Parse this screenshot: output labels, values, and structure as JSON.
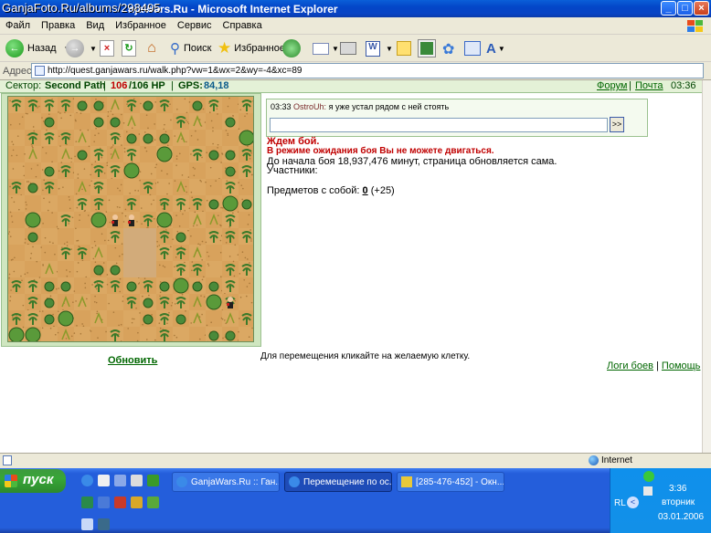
{
  "watermark": "GanjaFoto.Ru/albums/298495",
  "window": {
    "title": "njaWars.Ru - Microsoft Internet Explorer",
    "buttons": [
      "_",
      "□",
      "×"
    ]
  },
  "menu": [
    "Файл",
    "Правка",
    "Вид",
    "Избранное",
    "Сервис",
    "Справка"
  ],
  "toolbar": {
    "back": "Назад",
    "search": "Поиск",
    "favorites": "Избранное"
  },
  "address": {
    "label": "Адрес:",
    "url": "http://quest.ganjawars.ru/walk.php?vw=1&wx=2&wy=-4&xc=89"
  },
  "game": {
    "sector_label": "Сектор:",
    "sector": "Second Path",
    "hp_current": "106",
    "hp_max": "/106 HP",
    "gps_label": "GPS:",
    "gps": "84,18",
    "forum": "Форум",
    "separator": "|",
    "mail": "Почта",
    "time": "03:36",
    "chat_time": "03:33",
    "chat_user": "OstroUh:",
    "chat_text": "я уже устал рядом с ней стоять",
    "send": ">>",
    "wait": "Ждем бой.",
    "no_move": "В режиме ожидания боя Вы не можете двигаться.",
    "countdown": "До начала боя 18,937,476 минут, страница обновляется сама.",
    "participants": "Участники:",
    "items_label": "Предметов с собой:",
    "items_count": "0",
    "items_extra": "(+25)",
    "refresh": "Обновить",
    "hint": "Для перемещения кликайте на желаемую клетку.",
    "battle_logs": "Логи боев",
    "help": "Помощь"
  },
  "status": {
    "zone": "Internet"
  },
  "taskbar": {
    "start": "пуск",
    "tasks": [
      "GanjaWars.Ru :: Ган...",
      "Перемещение по ос...",
      "[285-476-452] - Окн..."
    ],
    "lang": "RL",
    "clock": "3:36",
    "weekday": "вторник",
    "date": "03.01.2006"
  },
  "colors": {
    "xp_blue": "#245edb",
    "game_green": "#e4f1d7",
    "hp_red": "#c00000",
    "link": "#006600"
  }
}
